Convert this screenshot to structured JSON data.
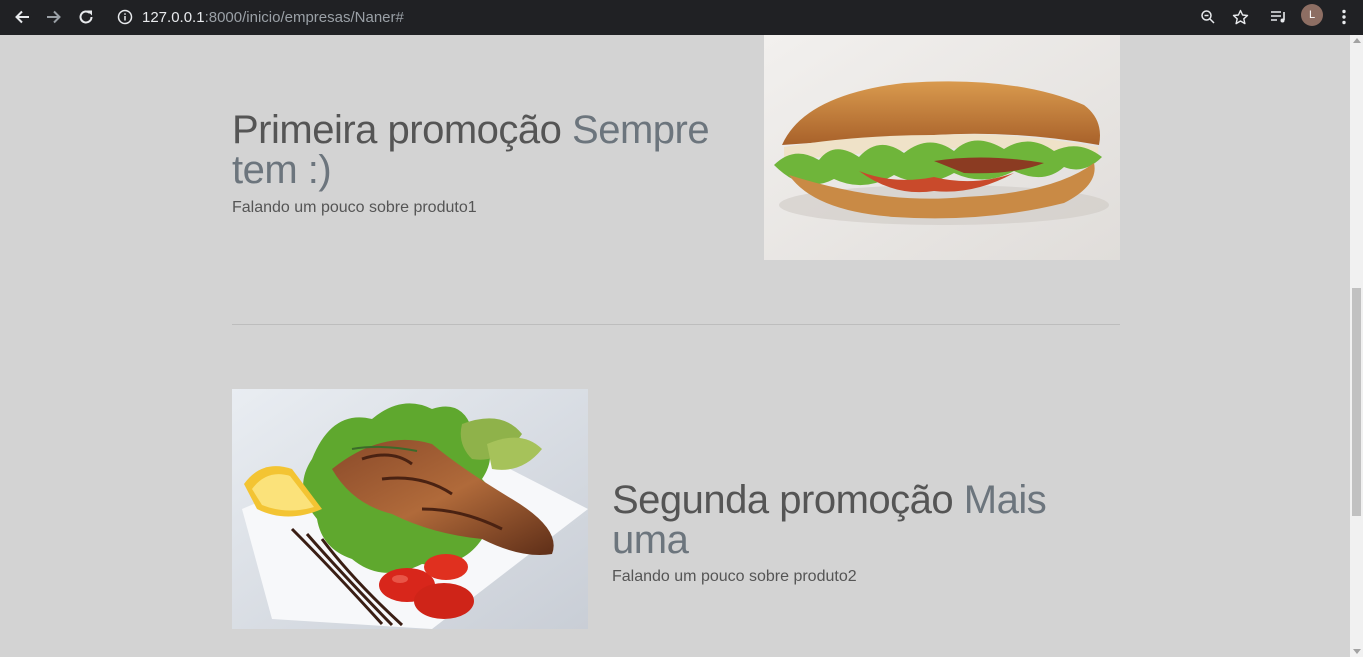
{
  "browser": {
    "url_host": "127.0.0.1",
    "url_path": ":8000/inicio/empresas/Naner#",
    "profile_initial": "L"
  },
  "featurettes": [
    {
      "heading": "Primeira promoção",
      "heading_muted": "Sempre tem :)",
      "lead": "Falando um pouco sobre produto1",
      "image": "sandwich-image"
    },
    {
      "heading": "Segunda promoção",
      "heading_muted": "Mais uma",
      "lead": "Falando um pouco sobre produto2",
      "image": "salmon-plate-image"
    }
  ]
}
